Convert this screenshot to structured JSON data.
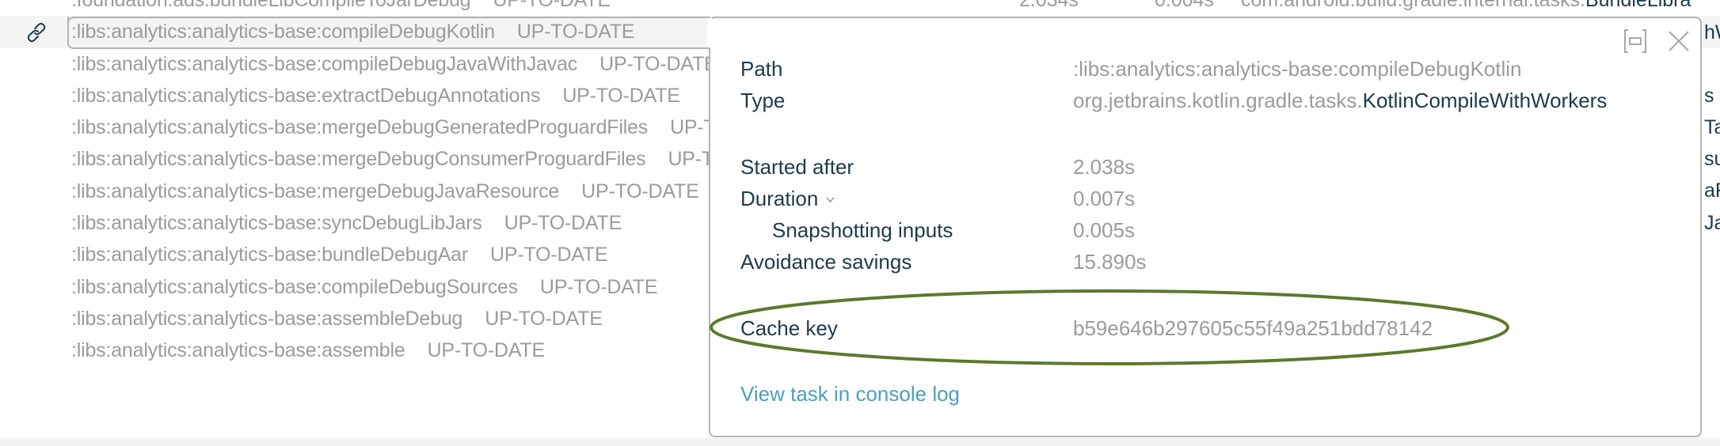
{
  "task_list": {
    "rows": [
      {
        "name": ":foundation:ads:bundleLibCompileToJarDebug",
        "status": "UP-TO-DATE",
        "started": "2.034s",
        "duration": "0.004s",
        "type_prefix": "com.android.build.gradle.internal.tasks.",
        "type_name": "BundleLibra"
      },
      {
        "name": ":libs:analytics:analytics-base:compileDebugKotlin",
        "status": "UP-TO-DATE",
        "selected": true,
        "right_fragment": "hW"
      },
      {
        "name": ":libs:analytics:analytics-base:compileDebugJavaWithJavac",
        "status": "UP-TO-DATE",
        "right_fragment": ""
      },
      {
        "name": ":libs:analytics:analytics-base:extractDebugAnnotations",
        "status": "UP-TO-DATE",
        "right_fragment": "s"
      },
      {
        "name": ":libs:analytics:analytics-base:mergeDebugGeneratedProguardFiles",
        "status": "UP-TO-DATE",
        "right_fragment": "Tas"
      },
      {
        "name": ":libs:analytics:analytics-base:mergeDebugConsumerProguardFiles",
        "status": "UP-TO-DATE",
        "right_fragment": "su"
      },
      {
        "name": ":libs:analytics:analytics-base:mergeDebugJavaResource",
        "status": "UP-TO-DATE",
        "right_fragment": "aR"
      },
      {
        "name": ":libs:analytics:analytics-base:syncDebugLibJars",
        "status": "UP-TO-DATE",
        "right_fragment": "Ja"
      },
      {
        "name": ":libs:analytics:analytics-base:bundleDebugAar",
        "status": "UP-TO-DATE"
      },
      {
        "name": ":libs:analytics:analytics-base:compileDebugSources",
        "status": "UP-TO-DATE"
      },
      {
        "name": ":libs:analytics:analytics-base:assembleDebug",
        "status": "UP-TO-DATE"
      },
      {
        "name": ":libs:analytics:analytics-base:assemble",
        "status": "UP-TO-DATE"
      }
    ]
  },
  "popup": {
    "icons": {
      "pin": "collapse-panel-icon",
      "close": "close-icon",
      "row_link": "link-icon"
    },
    "path_label": "Path",
    "path_value": ":libs:analytics:analytics-base:compileDebugKotlin",
    "type_label": "Type",
    "type_prefix": "org.jetbrains.kotlin.gradle.tasks.",
    "type_name": "KotlinCompileWithWorkers",
    "started_label": "Started after",
    "started_value": "2.038s",
    "duration_label": "Duration",
    "duration_value": "0.007s",
    "snapshot_label": "Snapshotting inputs",
    "snapshot_value": "0.005s",
    "avoidance_label": "Avoidance savings",
    "avoidance_value": "15.890s",
    "cache_key_label": "Cache key",
    "cache_key_value": "b59e646b297605c55f49a251bdd78142",
    "console_link": "View task in console log"
  },
  "colors": {
    "label_dark": "#1d3a4a",
    "value_gray": "#9b9b9b",
    "link": "#4a9fc0",
    "annotation_ellipse": "#5a7a2a",
    "row_highlight": "#f4f4f4",
    "border": "#b4b4b4"
  }
}
